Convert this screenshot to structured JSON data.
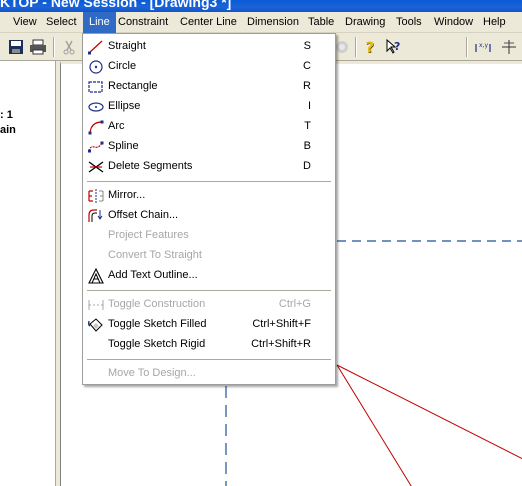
{
  "window": {
    "title": "KTOP - New Session - [Drawing3 *]"
  },
  "menubar": {
    "items": [
      {
        "label": "View"
      },
      {
        "label": "Select"
      },
      {
        "label": "Line"
      },
      {
        "label": "Constraint"
      },
      {
        "label": "Center Line"
      },
      {
        "label": "Dimension"
      },
      {
        "label": "Table"
      },
      {
        "label": "Drawing"
      },
      {
        "label": "Tools"
      },
      {
        "label": "Window"
      },
      {
        "label": "Help"
      }
    ],
    "active": "Line"
  },
  "left_panel": {
    "line1": ": 1",
    "line2": "ain"
  },
  "line_menu": {
    "items": [
      {
        "label": "Straight",
        "shortcut": "S",
        "icon": "straight-line-icon",
        "enabled": true
      },
      {
        "label": "Circle",
        "shortcut": "C",
        "icon": "circle-icon",
        "enabled": true
      },
      {
        "label": "Rectangle",
        "shortcut": "R",
        "icon": "rectangle-icon",
        "enabled": true
      },
      {
        "label": "Ellipse",
        "shortcut": "I",
        "icon": "ellipse-icon",
        "enabled": true
      },
      {
        "label": "Arc",
        "shortcut": "T",
        "icon": "arc-icon",
        "enabled": true
      },
      {
        "label": "Spline",
        "shortcut": "B",
        "icon": "spline-icon",
        "enabled": true
      },
      {
        "label": "Delete Segments",
        "shortcut": "D",
        "icon": "delete-segments-icon",
        "enabled": true
      },
      {
        "label": "Mirror...",
        "shortcut": "",
        "icon": "mirror-icon",
        "enabled": true
      },
      {
        "label": "Offset Chain...",
        "shortcut": "",
        "icon": "offset-chain-icon",
        "enabled": true
      },
      {
        "label": "Project Features",
        "shortcut": "",
        "icon": "",
        "enabled": false
      },
      {
        "label": "Convert To Straight",
        "shortcut": "",
        "icon": "",
        "enabled": false
      },
      {
        "label": "Add Text Outline...",
        "shortcut": "",
        "icon": "text-outline-icon",
        "enabled": true
      },
      {
        "label": "Toggle Construction",
        "shortcut": "Ctrl+G",
        "icon": "construction-icon",
        "enabled": false
      },
      {
        "label": "Toggle Sketch Filled",
        "shortcut": "Ctrl+Shift+F",
        "icon": "fill-bucket-icon",
        "enabled": true
      },
      {
        "label": "Toggle Sketch Rigid",
        "shortcut": "Ctrl+Shift+R",
        "icon": "",
        "enabled": true
      },
      {
        "label": "Move To Design...",
        "shortcut": "",
        "icon": "",
        "enabled": false
      }
    ]
  },
  "colors": {
    "menu_highlight": "#316ac5",
    "sketch_line": "#c00000",
    "centerline": "#1f4f9a",
    "disabled_text": "#a7a6aa"
  }
}
